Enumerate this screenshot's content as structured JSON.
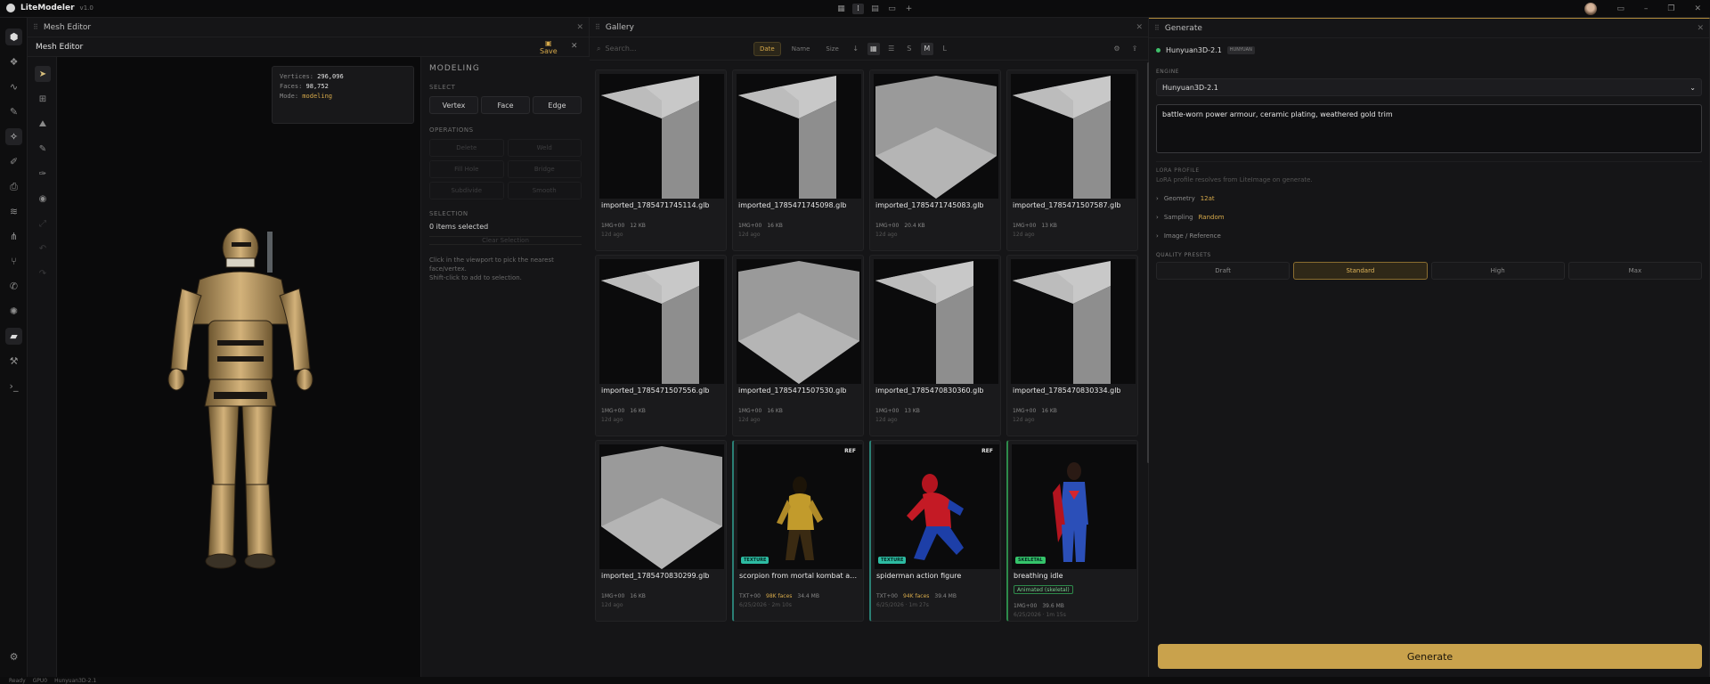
{
  "app": {
    "name": "LiteModeler",
    "version": "v1.0"
  },
  "mesh_panel": {
    "tab_title": "Mesh Editor",
    "title": "Mesh Editor",
    "save_label": "Save",
    "stats": {
      "vertices_label": "Vertices:",
      "vertices": "296,096",
      "faces_label": "Faces:",
      "faces": "98,752",
      "mode_label": "Mode:",
      "mode": "modeling"
    },
    "modeling": {
      "heading": "MODELING",
      "select_label": "SELECT",
      "select_modes": [
        "Vertex",
        "Face",
        "Edge"
      ],
      "operations_label": "OPERATIONS",
      "operations": [
        "Delete",
        "Weld",
        "Fill Hole",
        "Bridge",
        "Subdivide",
        "Smooth"
      ],
      "selection_label": "SELECTION",
      "selection_count": "0 items selected",
      "clear_label": "Clear Selection",
      "hint_1": "Click in the viewport to pick the nearest face/vertex.",
      "hint_2": "Shift-click to add to selection."
    }
  },
  "gallery": {
    "title": "Gallery",
    "search_placeholder": "Search...",
    "sort": [
      "Date",
      "Name",
      "Size"
    ],
    "sizes": [
      "S",
      "M",
      "L"
    ],
    "items": [
      {
        "name": "imported_1785471745114.glb",
        "badge": "1MG+00",
        "size": "12 KB",
        "age": "12d ago",
        "kind": "box"
      },
      {
        "name": "imported_1785471745098.glb",
        "badge": "1MG+00",
        "size": "16 KB",
        "age": "12d ago",
        "kind": "box"
      },
      {
        "name": "imported_1785471745083.glb",
        "badge": "1MG+00",
        "size": "20.4 KB",
        "age": "12d ago",
        "kind": "shield"
      },
      {
        "name": "imported_1785471507587.glb",
        "badge": "1MG+00",
        "size": "13 KB",
        "age": "12d ago",
        "kind": "box"
      },
      {
        "name": "imported_1785471507556.glb",
        "badge": "1MG+00",
        "size": "16 KB",
        "age": "12d ago",
        "kind": "box"
      },
      {
        "name": "imported_1785471507530.glb",
        "badge": "1MG+00",
        "size": "16 KB",
        "age": "12d ago",
        "kind": "shield"
      },
      {
        "name": "imported_1785470830360.glb",
        "badge": "1MG+00",
        "size": "13 KB",
        "age": "12d ago",
        "kind": "box"
      },
      {
        "name": "imported_1785470830334.glb",
        "badge": "1MG+00",
        "size": "16 KB",
        "age": "12d ago",
        "kind": "box"
      },
      {
        "name": "imported_1785470830299.glb",
        "badge": "1MG+00",
        "size": "16 KB",
        "age": "12d ago",
        "kind": "shield"
      },
      {
        "name": "scorpion from mortal kombat action figure",
        "badge": "TXT+00",
        "faces": "98K faces",
        "size": "34.4 MB",
        "age": "6/25/2026 · 2m 10s",
        "kind": "scorpion",
        "ref": "REF",
        "tag": "TEXTURE"
      },
      {
        "name": "spiderman action figure",
        "badge": "TXT+00",
        "faces": "94K faces",
        "size": "39.4 MB",
        "age": "6/25/2026 · 1m 27s",
        "kind": "spider",
        "ref": "REF",
        "tag": "TEXTURE"
      },
      {
        "name": "breathing idle",
        "badge": "1MG+00",
        "size": "39.6 MB",
        "age": "6/25/2026 · 1m 15s",
        "kind": "super",
        "tag": "SKELETAL",
        "anim": "Animated (skeletal)"
      }
    ]
  },
  "generate": {
    "title": "Generate",
    "model": "Hunyuan3D-2.1",
    "model_badge": "HUNYUAN",
    "engine_label": "ENGINE",
    "engine_value": "Hunyuan3D-2.1",
    "prompt": "battle-worn power armour, ceramic plating, weathered gold trim",
    "lora_label": "LORA PROFILE",
    "lora_desc": "LoRA profile resolves from LiteImage on generate.",
    "geometry_label": "Geometry",
    "geometry_value": "12at",
    "sampling_label": "Sampling",
    "sampling_value": "Random",
    "image_ref_label": "Image / Reference",
    "presets_label": "QUALITY PRESETS",
    "presets": [
      "Draft",
      "Standard",
      "High",
      "Max"
    ],
    "button": "Generate"
  },
  "status": {
    "left": "Ready",
    "mid": "GPU0",
    "model": "Hunyuan3D-2.1"
  }
}
